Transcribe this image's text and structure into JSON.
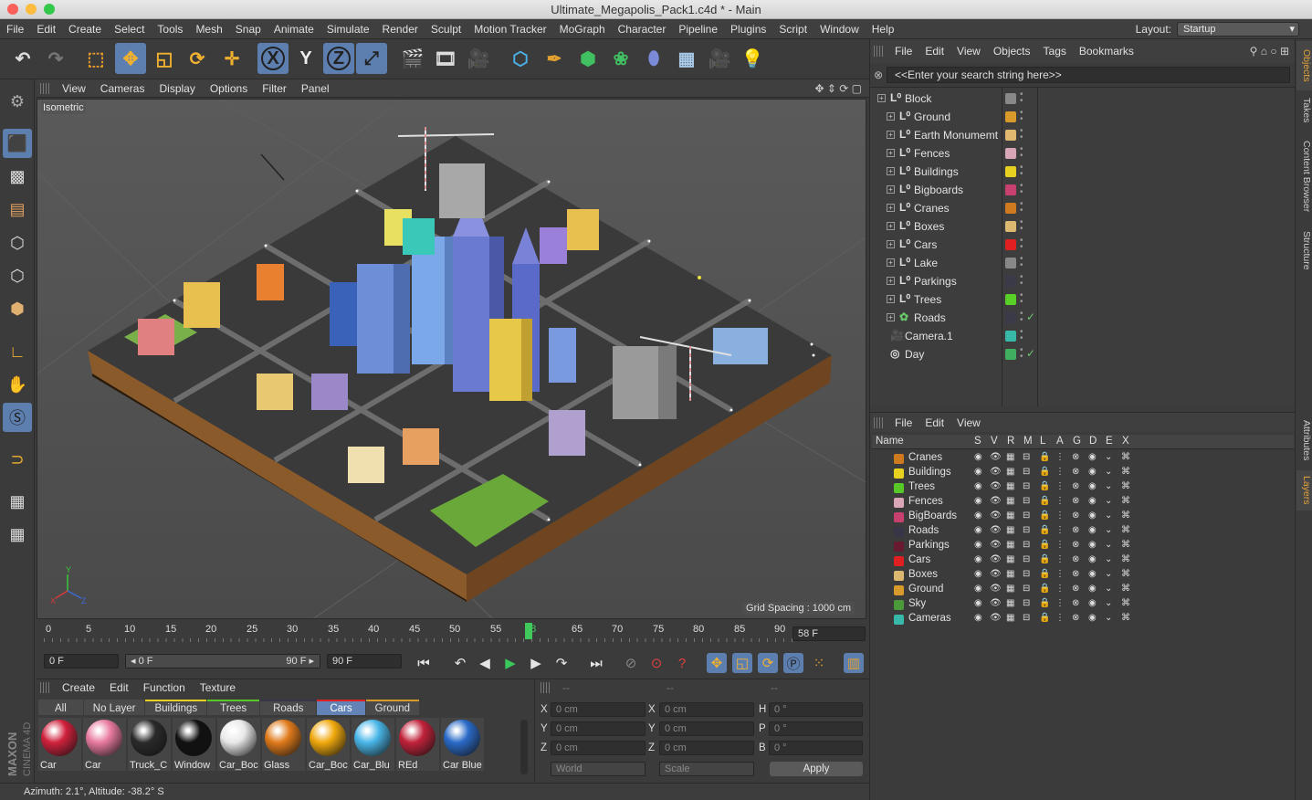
{
  "window": {
    "title": "Ultimate_Megapolis_Pack1.c4d * - Main"
  },
  "menubar": {
    "items": [
      "File",
      "Edit",
      "Create",
      "Select",
      "Tools",
      "Mesh",
      "Snap",
      "Animate",
      "Simulate",
      "Render",
      "Sculpt",
      "Motion Tracker",
      "MoGraph",
      "Character",
      "Pipeline",
      "Plugins",
      "Script",
      "Window",
      "Help"
    ],
    "layout_label": "Layout:",
    "layout_value": "Startup"
  },
  "toolbar": {
    "x_label": "X",
    "y_label": "Y",
    "z_label": "Z"
  },
  "viewport": {
    "menu": [
      "View",
      "Cameras",
      "Display",
      "Options",
      "Filter",
      "Panel"
    ],
    "view_name": "Isometric",
    "grid_spacing": "Grid Spacing : 1000 cm"
  },
  "timeline": {
    "ticks": [
      "0",
      "5",
      "10",
      "15",
      "20",
      "25",
      "30",
      "35",
      "40",
      "45",
      "50",
      "55",
      "58",
      "65",
      "70",
      "75",
      "80",
      "85",
      "90"
    ],
    "current_frame": "58 F",
    "current_frame_value": 58
  },
  "transport": {
    "start": "0 F",
    "range_start": "◂ 0 F",
    "range_end": "90 F ▸",
    "end": "90 F"
  },
  "material": {
    "menu": [
      "Create",
      "Edit",
      "Function",
      "Texture"
    ],
    "tabs": [
      "All",
      "No Layer",
      "Buildings",
      "Trees",
      "Roads",
      "Cars",
      "Ground"
    ],
    "active_tab": "Cars",
    "items": [
      {
        "name": "Car",
        "color": "#d0213c"
      },
      {
        "name": "Car",
        "color": "#e97ba0"
      },
      {
        "name": "Truck_C",
        "color": "#2a2a2a"
      },
      {
        "name": "Window",
        "color": "#111111"
      },
      {
        "name": "Car_Boc",
        "color": "#e8e8e8"
      },
      {
        "name": "Glass",
        "color": "#e07a1a"
      },
      {
        "name": "Car_Boc",
        "color": "#f0a90c"
      },
      {
        "name": "Car_Blu",
        "color": "#49b6e8"
      },
      {
        "name": "REd",
        "color": "#c0223a"
      },
      {
        "name": "Car Blue",
        "color": "#2a6ac8"
      }
    ]
  },
  "coords": {
    "header": [
      "--",
      "--",
      "--"
    ],
    "rows": [
      {
        "a": "X",
        "av": "0 cm",
        "b": "X",
        "bv": "0 cm",
        "c": "H",
        "cv": "0 °"
      },
      {
        "a": "Y",
        "av": "0 cm",
        "b": "Y",
        "bv": "0 cm",
        "c": "P",
        "cv": "0 °"
      },
      {
        "a": "Z",
        "av": "0 cm",
        "b": "Z",
        "bv": "0 cm",
        "c": "B",
        "cv": "0 °"
      }
    ],
    "world": "World",
    "scale": "Scale",
    "apply": "Apply"
  },
  "status": "Azimuth: 2.1°, Altitude: -38.2°  S",
  "objects": {
    "menu": [
      "File",
      "Edit",
      "View",
      "Objects",
      "Tags",
      "Bookmarks"
    ],
    "search_placeholder": "<<Enter your search string here>>",
    "items": [
      {
        "name": "Block",
        "color": "#888888",
        "level": 0
      },
      {
        "name": "Ground",
        "color": "#d89a2a",
        "level": 1
      },
      {
        "name": "Earth Monumemt",
        "color": "#e0b870",
        "level": 1
      },
      {
        "name": "Fences",
        "color": "#d9a6b8",
        "level": 1
      },
      {
        "name": "Buildings",
        "color": "#e8d020",
        "level": 1
      },
      {
        "name": "Bigboards",
        "color": "#c84070",
        "level": 1
      },
      {
        "name": "Cranes",
        "color": "#d07a20",
        "level": 1
      },
      {
        "name": "Boxes",
        "color": "#dcb870",
        "level": 1
      },
      {
        "name": "Cars",
        "color": "#e02020",
        "level": 1
      },
      {
        "name": "Lake",
        "color": "#888888",
        "level": 1
      },
      {
        "name": "Parkings",
        "color": "#3a3a48",
        "level": 1
      },
      {
        "name": "Trees",
        "color": "#58d028",
        "level": 1
      },
      {
        "name": "Roads",
        "color": "#3a3a48",
        "level": 1
      },
      {
        "name": "Camera.1",
        "color": "#38b8a8",
        "level": 0
      },
      {
        "name": "Day",
        "color": "#40b060",
        "level": 0
      }
    ]
  },
  "layers": {
    "menu": [
      "File",
      "Edit",
      "View"
    ],
    "columns": [
      "Name",
      "S",
      "V",
      "R",
      "M",
      "L",
      "A",
      "G",
      "D",
      "E",
      "X"
    ],
    "items": [
      {
        "name": "Cranes",
        "color": "#d07a20"
      },
      {
        "name": "Buildings",
        "color": "#e8d020"
      },
      {
        "name": "Trees",
        "color": "#58c828"
      },
      {
        "name": "Fences",
        "color": "#d9a6b8"
      },
      {
        "name": "BigBoards",
        "color": "#c84070"
      },
      {
        "name": "Roads",
        "color": "#363648"
      },
      {
        "name": "Parkings",
        "color": "#6a1a30"
      },
      {
        "name": "Cars",
        "color": "#e02020"
      },
      {
        "name": "Boxes",
        "color": "#dcb870"
      },
      {
        "name": "Ground",
        "color": "#d89a2a"
      },
      {
        "name": "Sky",
        "color": "#4a9a3a"
      },
      {
        "name": "Cameras",
        "color": "#38b8a8"
      }
    ]
  },
  "sidetabs": [
    "Objects",
    "Takes",
    "Content Browser",
    "Structure",
    "Attributes",
    "Layers"
  ],
  "branding": "MAXON CINEMA 4D"
}
